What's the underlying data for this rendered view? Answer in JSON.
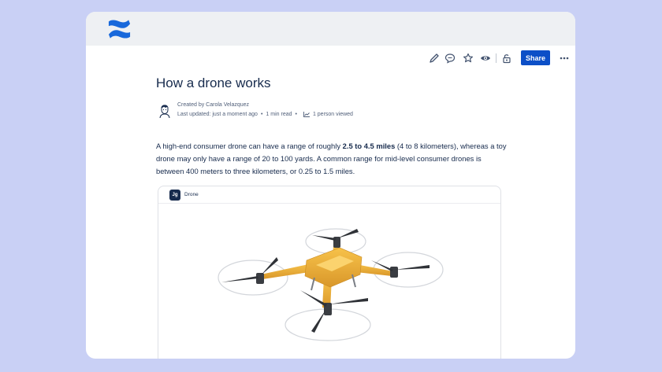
{
  "toolbar": {
    "share_label": "Share",
    "icons": [
      "pencil-icon",
      "comment-icon",
      "star-icon",
      "eye-icon",
      "lock-icon",
      "more-icon"
    ]
  },
  "page": {
    "title": "How a drone works",
    "created_by": "Created by Carola Velazquez",
    "last_updated": "Last updated: just a moment ago",
    "read_time": "1 min read",
    "viewed": "1 person viewed",
    "body_before_bold": "A high-end consumer drone can have a range of roughly ",
    "body_bold": "2.5 to 4.5 miles",
    "body_after_bold": " (4 to 8 kilometers), whereas a toy drone may only have a range of 20 to 100 yards. A common range for mid-level consumer drones is between 400 meters to three kilometers, or 0.25 to 1.5 miles."
  },
  "embed": {
    "app_icon_text": "Jg",
    "title": "Drone"
  },
  "colors": {
    "background": "#c9d0f5",
    "topbar": "#eef0f3",
    "share_button": "#0c4fc7",
    "drone_body": "#f2b53a",
    "text": "#172b4d"
  }
}
